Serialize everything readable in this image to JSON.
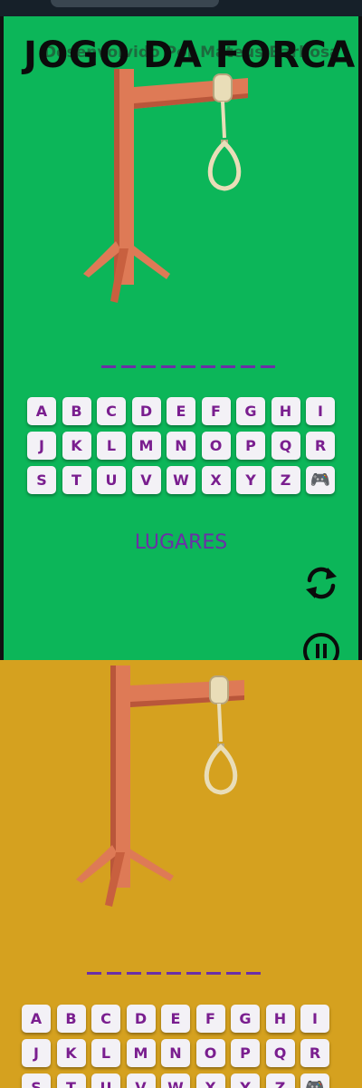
{
  "app": {
    "title": "JOGO  DA FORCA",
    "credit": "Desenvolvido Por Mateus Barbosa"
  },
  "colors": {
    "screen1_background": "#0cb659",
    "screen2_background": "#d5a11f",
    "key_text": "#7a1e8f",
    "key_face": "#f3f1f6",
    "blank_line": "#6b2fa6"
  },
  "game": {
    "word_length": 9,
    "hint_label": "LUGARES"
  },
  "keyboard": {
    "keys": [
      "A",
      "B",
      "C",
      "D",
      "E",
      "F",
      "G",
      "H",
      "I",
      "J",
      "K",
      "L",
      "M",
      "N",
      "O",
      "P",
      "Q",
      "R",
      "S",
      "T",
      "U",
      "V",
      "W",
      "X",
      "Y",
      "Z",
      "🎮"
    ]
  },
  "icons": {
    "restart": "refresh-icon",
    "pause": "pause-icon",
    "gamepad": "gamepad-icon"
  }
}
